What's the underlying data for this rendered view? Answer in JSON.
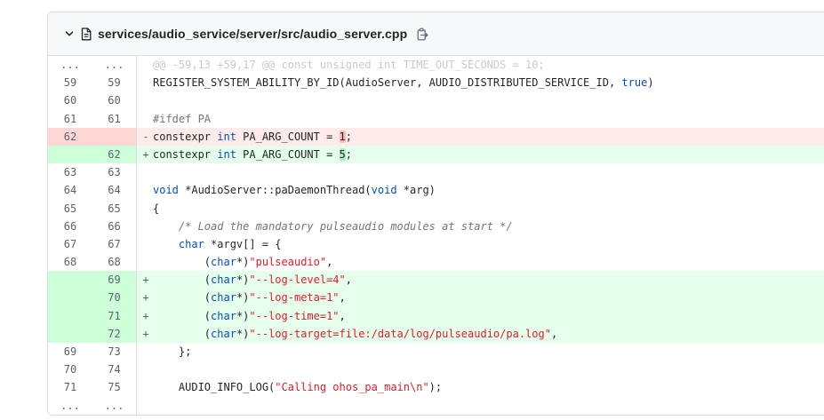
{
  "file": {
    "path": "services/audio_service/server/src/audio_server.cpp"
  },
  "colors": {
    "deleted_line_bg": "#ffebe9",
    "deleted_num_bg": "#ffd7d5",
    "added_line_bg": "#e6ffec",
    "added_num_bg": "#ccffd8",
    "keyword": "#0550ae",
    "string": "#cf222e"
  },
  "icons": [
    "chevron-down-icon",
    "file-icon",
    "copy-icon"
  ],
  "diff": {
    "hunk_old": "...",
    "hunk_new": "...",
    "hunk_header": "@@ -59,13 +59,17 @@ const unsigned int TIME_OUT_SECONDS = 10;",
    "footer_old": "...",
    "footer_new": "...",
    "lines": [
      {
        "old": "59",
        "new": "59",
        "type": "ctx",
        "marker": "",
        "tokens": [
          {
            "t": "REGISTER_SYSTEM_ABILITY_BY_ID(AudioServer, AUDIO_DISTRIBUTED_SERVICE_ID, "
          },
          {
            "t": "true",
            "c": "kw"
          },
          {
            "t": ")"
          }
        ]
      },
      {
        "old": "60",
        "new": "60",
        "type": "ctx",
        "marker": "",
        "tokens": [
          {
            "t": ""
          }
        ]
      },
      {
        "old": "61",
        "new": "61",
        "type": "ctx",
        "marker": "",
        "tokens": [
          {
            "t": "#ifdef PA",
            "c": "pp"
          }
        ]
      },
      {
        "old": "62",
        "new": "",
        "type": "del",
        "marker": "-",
        "tokens": [
          {
            "t": "constexpr "
          },
          {
            "t": "int",
            "c": "kw"
          },
          {
            "t": " PA_ARG_COUNT = "
          },
          {
            "t": "1",
            "c": "hl-del"
          },
          {
            "t": ";"
          }
        ]
      },
      {
        "old": "",
        "new": "62",
        "type": "add",
        "marker": "+",
        "tokens": [
          {
            "t": "constexpr "
          },
          {
            "t": "int",
            "c": "kw"
          },
          {
            "t": " PA_ARG_COUNT = "
          },
          {
            "t": "5",
            "c": "hl-add"
          },
          {
            "t": ";"
          }
        ]
      },
      {
        "old": "63",
        "new": "63",
        "type": "ctx",
        "marker": "",
        "tokens": [
          {
            "t": ""
          }
        ]
      },
      {
        "old": "64",
        "new": "64",
        "type": "ctx",
        "marker": "",
        "tokens": [
          {
            "t": "void",
            "c": "kw"
          },
          {
            "t": " *AudioServer::paDaemonThread("
          },
          {
            "t": "void",
            "c": "kw"
          },
          {
            "t": " *arg)"
          }
        ]
      },
      {
        "old": "65",
        "new": "65",
        "type": "ctx",
        "marker": "",
        "tokens": [
          {
            "t": "{"
          }
        ]
      },
      {
        "old": "66",
        "new": "66",
        "type": "ctx",
        "marker": "",
        "tokens": [
          {
            "t": "    "
          },
          {
            "t": "/* Load the mandatory pulseaudio modules at start */",
            "c": "cmt"
          }
        ]
      },
      {
        "old": "67",
        "new": "67",
        "type": "ctx",
        "marker": "",
        "tokens": [
          {
            "t": "    "
          },
          {
            "t": "char",
            "c": "kw"
          },
          {
            "t": " *argv[] = {"
          }
        ]
      },
      {
        "old": "68",
        "new": "68",
        "type": "ctx",
        "marker": "",
        "tokens": [
          {
            "t": "        ("
          },
          {
            "t": "char",
            "c": "kw"
          },
          {
            "t": "*)"
          },
          {
            "t": "\"pulseaudio\"",
            "c": "str"
          },
          {
            "t": ","
          }
        ]
      },
      {
        "old": "",
        "new": "69",
        "type": "add",
        "marker": "+",
        "tokens": [
          {
            "t": "        ("
          },
          {
            "t": "char",
            "c": "kw"
          },
          {
            "t": "*)"
          },
          {
            "t": "\"--log-level=4\"",
            "c": "str"
          },
          {
            "t": ","
          }
        ]
      },
      {
        "old": "",
        "new": "70",
        "type": "add",
        "marker": "+",
        "tokens": [
          {
            "t": "        ("
          },
          {
            "t": "char",
            "c": "kw"
          },
          {
            "t": "*)"
          },
          {
            "t": "\"--log-meta=1\"",
            "c": "str"
          },
          {
            "t": ","
          }
        ]
      },
      {
        "old": "",
        "new": "71",
        "type": "add",
        "marker": "+",
        "tokens": [
          {
            "t": "        ("
          },
          {
            "t": "char",
            "c": "kw"
          },
          {
            "t": "*)"
          },
          {
            "t": "\"--log-time=1\"",
            "c": "str"
          },
          {
            "t": ","
          }
        ]
      },
      {
        "old": "",
        "new": "72",
        "type": "add",
        "marker": "+",
        "tokens": [
          {
            "t": "        ("
          },
          {
            "t": "char",
            "c": "kw"
          },
          {
            "t": "*)"
          },
          {
            "t": "\"--log-target=file:/data/log/pulseaudio/pa.log\"",
            "c": "str"
          },
          {
            "t": ","
          }
        ]
      },
      {
        "old": "69",
        "new": "73",
        "type": "ctx",
        "marker": "",
        "tokens": [
          {
            "t": "    };"
          }
        ]
      },
      {
        "old": "70",
        "new": "74",
        "type": "ctx",
        "marker": "",
        "tokens": [
          {
            "t": ""
          }
        ]
      },
      {
        "old": "71",
        "new": "75",
        "type": "ctx",
        "marker": "",
        "tokens": [
          {
            "t": "    AUDIO_INFO_LOG("
          },
          {
            "t": "\"Calling ohos_pa_main\\n\"",
            "c": "str"
          },
          {
            "t": ");"
          }
        ]
      }
    ]
  }
}
